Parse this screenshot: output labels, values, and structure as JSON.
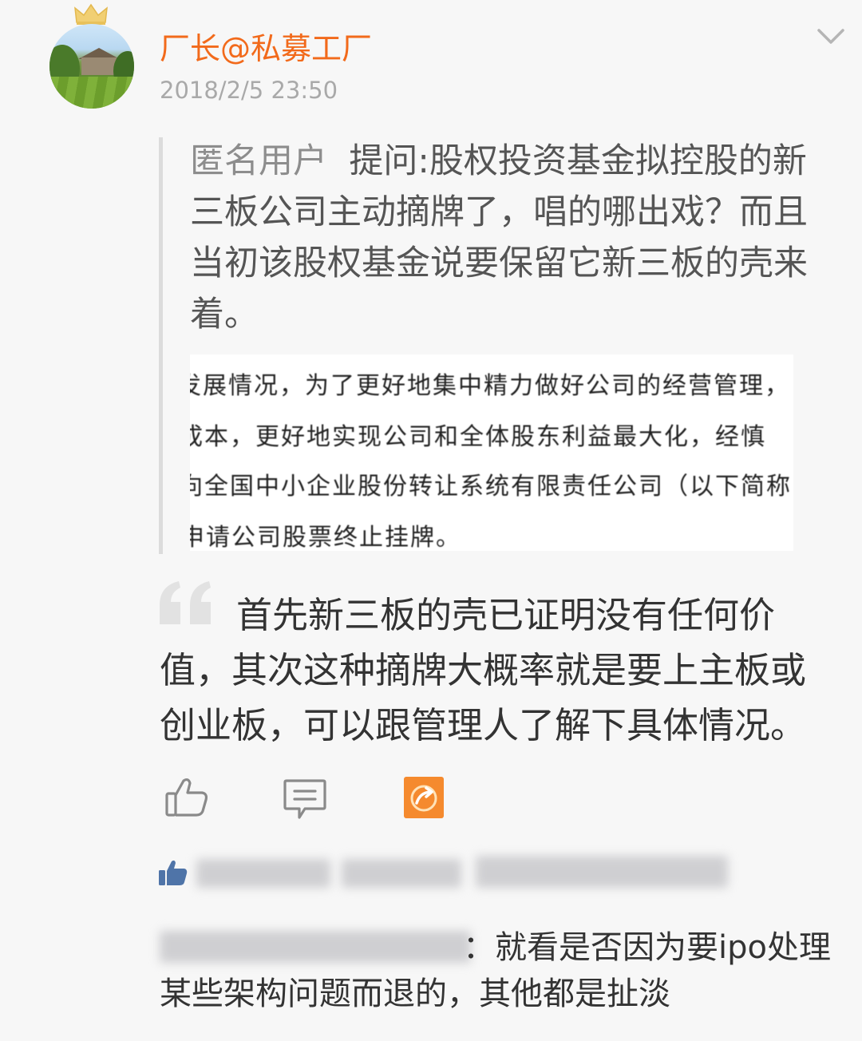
{
  "post": {
    "username": "厂长@私募工厂",
    "timestamp": "2018/2/5 23:50",
    "question": {
      "asker": "匿名用户",
      "label": "提问:",
      "text": "股权投资基金拟控股的新三板公司主动摘牌了，唱的哪出戏？而且当初该股权基金说要保留它新三板的壳来着。"
    },
    "document_image_lines": [
      "发展情况，为了更好地集中精力做好公司的经营管理，",
      "成本，更好地实现公司和全体股东利益最大化，经慎",
      "向全国中小企业股份转让系统有限责任公司（以下简称",
      "申请公司股票终止挂牌。"
    ],
    "answer": "首先新三板的壳已证明没有任何价值，其次这种摘牌大概率就是要上主板或创业板，可以跟管理人了解下具体情况。"
  },
  "reply": {
    "text": "：就看是否因为要ipo处理某些架构问题而退的，其他都是扯淡"
  },
  "colors": {
    "username": "#f26a1b",
    "timestamp": "#a9a9a9",
    "forward_icon_bg": "#f58a2e",
    "background": "#f7f7f7"
  },
  "icons": {
    "more": "chevron-down-icon",
    "like": "thumbs-up-icon",
    "comment": "comment-icon",
    "forward": "forward-icon",
    "likes": "thumbs-up-filled-icon"
  }
}
